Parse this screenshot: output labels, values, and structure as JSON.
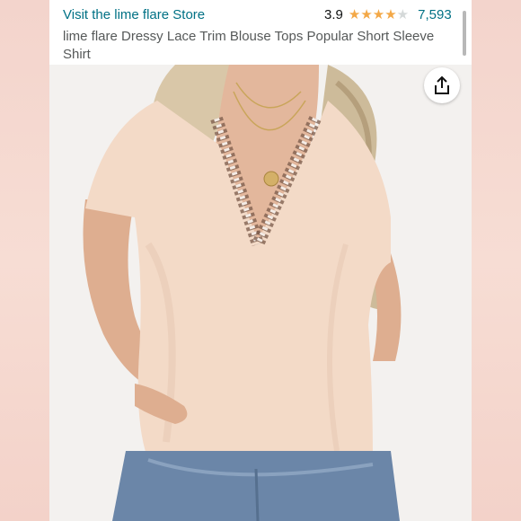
{
  "header": {
    "store_link": "Visit the lime flare Store",
    "rating_value": "3.9",
    "rating_stars": 3.9,
    "review_count": "7,593",
    "product_title": "lime flare Dressy Lace Trim Blouse Tops Popular Short Sleeve Shirt"
  },
  "image": {
    "subject": "woman wearing blush V-neck lace trim short sleeve blouse with jeans"
  },
  "icons": {
    "share": "share-icon",
    "star": "star-icon"
  },
  "colors": {
    "link": "#007185",
    "star": "#f3a847",
    "blouse": "#f3d9c8",
    "background": "#f6d9cf"
  }
}
